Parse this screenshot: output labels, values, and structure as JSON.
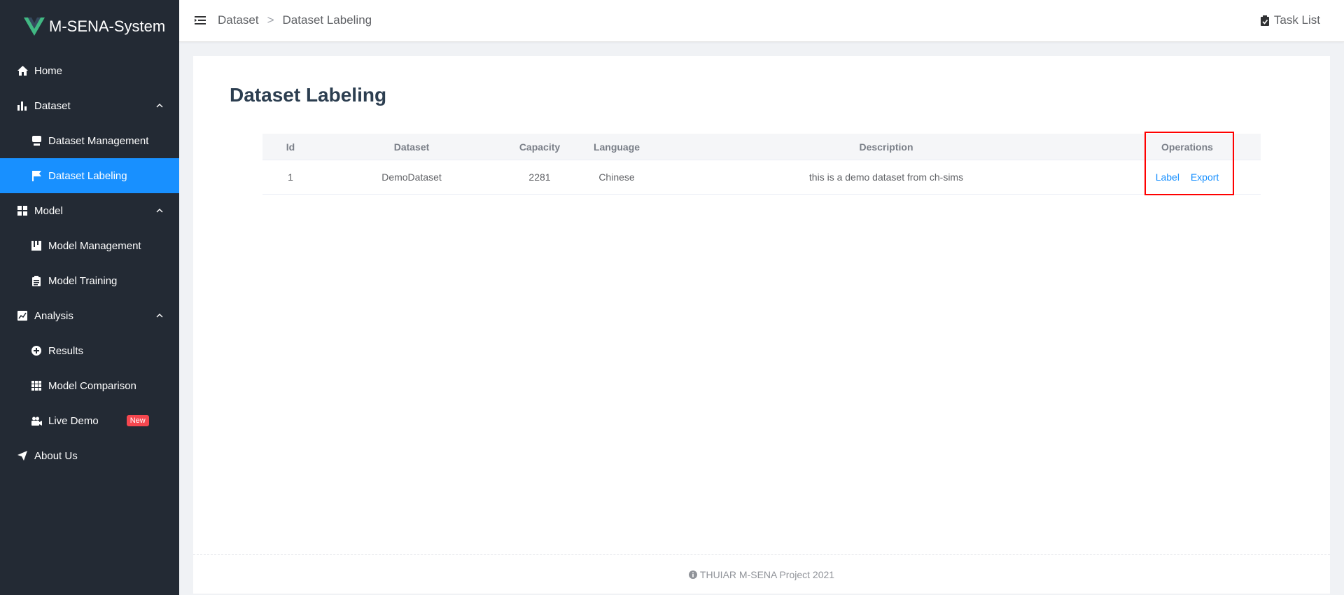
{
  "app": {
    "title": "M-SENA-System"
  },
  "colors": {
    "sidebar_bg": "#232a34",
    "accent": "#1890ff",
    "badge": "#f5474f",
    "highlight": "#ff0000"
  },
  "sidebar": {
    "items": [
      {
        "label": "Home",
        "icon": "home-icon"
      },
      {
        "label": "Dataset",
        "icon": "bar-chart-icon"
      },
      {
        "label": "Dataset Management",
        "icon": "database-icon"
      },
      {
        "label": "Dataset Labeling",
        "icon": "flag-icon"
      },
      {
        "label": "Model",
        "icon": "grid-icon"
      },
      {
        "label": "Model Management",
        "icon": "book-icon"
      },
      {
        "label": "Model Training",
        "icon": "clipboard-icon"
      },
      {
        "label": "Analysis",
        "icon": "line-chart-icon"
      },
      {
        "label": "Results",
        "icon": "plus-circle-icon"
      },
      {
        "label": "Model Comparison",
        "icon": "table-icon"
      },
      {
        "label": "Live Demo",
        "icon": "camera-icon",
        "badge": "New"
      },
      {
        "label": "About Us",
        "icon": "send-icon"
      }
    ]
  },
  "header": {
    "breadcrumb": [
      "Dataset",
      "Dataset Labeling"
    ],
    "breadcrumb_separator": ">",
    "task_list": "Task List"
  },
  "main": {
    "title": "Dataset Labeling",
    "table": {
      "columns": [
        "Id",
        "Dataset",
        "Capacity",
        "Language",
        "Description",
        "Operations"
      ],
      "rows": [
        {
          "id": "1",
          "dataset": "DemoDataset",
          "capacity": "2281",
          "language": "Chinese",
          "description": "this is a demo dataset from ch-sims",
          "ops": [
            "Label",
            "Export"
          ]
        }
      ]
    }
  },
  "footer": {
    "text": "THUIAR M-SENA Project 2021"
  }
}
